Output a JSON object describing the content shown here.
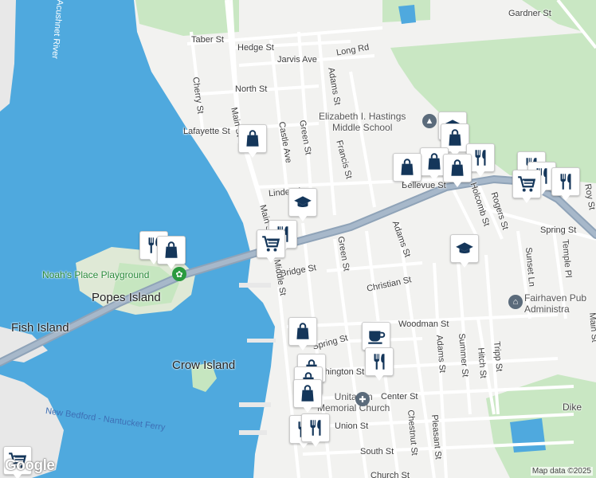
{
  "streets": {
    "taber": "Taber St",
    "hedge": "Hedge St",
    "jarvis": "Jarvis Ave",
    "long_rd": "Long Rd",
    "gardner": "Gardner St",
    "north": "North St",
    "adams_n": "Adams St",
    "cherry": "Cherry St",
    "main_n": "Main St",
    "castle": "Castle Ave",
    "green_n": "Green St",
    "francis": "Francis St",
    "lafayette": "Lafayette St",
    "linden": "Linden Ave",
    "bellevue": "Bellevue St",
    "holcomb": "Holcomb St",
    "rogers": "Rogers St",
    "roy": "Roy St",
    "spring_e": "Spring St",
    "sunset": "Sunset Ln",
    "temple": "Temple Pl",
    "adams_m": "Adams St",
    "green_m": "Green St",
    "christian": "Christian St",
    "bridge": "Bridge St",
    "middle": "Middle St",
    "main_s": "Main St",
    "woodman": "Woodman St",
    "spring_w": "Spring St",
    "washington": "Washington St",
    "adams_s": "Adams St",
    "summer": "Summer St",
    "hitch": "Hitch St",
    "tripp": "Tripp St",
    "center": "Center St",
    "union": "Union St",
    "chestnut": "Chestnut St",
    "pleasant": "Pleasant St",
    "south": "South St",
    "church": "Church St",
    "acushnet": "Acushnet River",
    "main_e": "Main St"
  },
  "places": {
    "school": "Elizabeth I. Hastings Middle School",
    "school_line1": "Elizabeth I. Hastings",
    "school_line2": "Middle School",
    "playground": "Noah's Place Playground",
    "popes": "Popes Island",
    "fish": "Fish Island",
    "crow": "Crow Island",
    "ferry": "New Bedford - Nantucket Ferry",
    "fairhaven_line1": "Fairhaven Pub",
    "fairhaven_line2": "Administra",
    "church_line1": "Unitarian",
    "church_line2": "Memorial Church",
    "dike": "Dike"
  },
  "attribution": "Map data ©2025",
  "logo": "Google",
  "colors": {
    "water": "#4fa9de",
    "land": "#f2f2f0",
    "park": "#c6e6c0",
    "road": "#ffffff",
    "highway": "#8fa3b8",
    "pin": "#14365a"
  },
  "markers": [
    {
      "icon": "shopping-bag",
      "name": "shop-marker"
    },
    {
      "icon": "school",
      "name": "school-marker"
    },
    {
      "icon": "restaurant",
      "name": "restaurant-marker"
    },
    {
      "icon": "grocery-cart",
      "name": "grocery-marker"
    },
    {
      "icon": "cafe",
      "name": "cafe-marker"
    }
  ]
}
